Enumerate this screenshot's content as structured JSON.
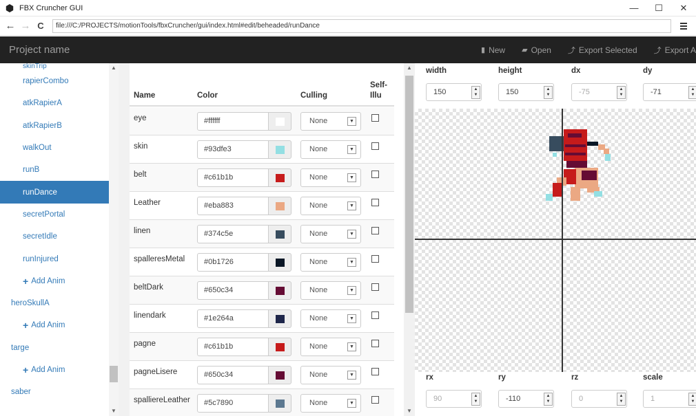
{
  "window": {
    "title": "FBX Cruncher GUI",
    "minimize": "—",
    "maximize": "☐",
    "close": "✕"
  },
  "browser": {
    "back": "←",
    "forward": "→",
    "reload": "C",
    "url": "file:///C:/PROJECTS/motionTools/fbxCruncher/gui/index.html#edit/beheaded/runDance"
  },
  "navbar": {
    "brand": "Project name",
    "items": [
      {
        "icon": "file-icon",
        "glyph": "▮",
        "label": "New"
      },
      {
        "icon": "folder-open-icon",
        "glyph": "▰",
        "label": "Open"
      },
      {
        "icon": "export-icon",
        "glyph": "⤴",
        "label": "Export Selected"
      },
      {
        "icon": "export-all-icon",
        "glyph": "⤴",
        "label": "Export A"
      }
    ]
  },
  "sidebar": {
    "cut_item": "skinTrip",
    "items": [
      {
        "label": "rapierCombo",
        "kind": "anim"
      },
      {
        "label": "atkRapierA",
        "kind": "anim"
      },
      {
        "label": "atkRapierB",
        "kind": "anim"
      },
      {
        "label": "walkOut",
        "kind": "anim"
      },
      {
        "label": "runB",
        "kind": "anim"
      },
      {
        "label": "runDance",
        "kind": "anim",
        "active": true
      },
      {
        "label": "secretPortal",
        "kind": "anim"
      },
      {
        "label": "secretIdle",
        "kind": "anim"
      },
      {
        "label": "runInjured",
        "kind": "anim"
      },
      {
        "label": "Add Anim",
        "kind": "add"
      },
      {
        "label": "heroSkullA",
        "kind": "group"
      },
      {
        "label": "Add Anim",
        "kind": "add"
      },
      {
        "label": "targe",
        "kind": "group"
      },
      {
        "label": "Add Anim",
        "kind": "add"
      },
      {
        "label": "saber",
        "kind": "group"
      }
    ]
  },
  "materials": {
    "headers": {
      "name": "Name",
      "color": "Color",
      "culling": "Culling",
      "selfillum_1": "Self-",
      "selfillum_2": "Illu"
    },
    "rows": [
      {
        "name": "eye",
        "color": "#ffffff",
        "culling": "None"
      },
      {
        "name": "skin",
        "color": "#93dfe3",
        "culling": "None"
      },
      {
        "name": "belt",
        "color": "#c61b1b",
        "culling": "None"
      },
      {
        "name": "Leather",
        "color": "#eba883",
        "culling": "None"
      },
      {
        "name": "linen",
        "color": "#374c5e",
        "culling": "None"
      },
      {
        "name": "spalleresMetal",
        "color": "#0b1726",
        "culling": "None"
      },
      {
        "name": "beltDark",
        "color": "#650c34",
        "culling": "None"
      },
      {
        "name": "linendark",
        "color": "#1e264a",
        "culling": "None"
      },
      {
        "name": "pagne",
        "color": "#c61b1b",
        "culling": "None"
      },
      {
        "name": "pagneLisere",
        "color": "#650c34",
        "culling": "None"
      },
      {
        "name": "spalliereLeather",
        "color": "#5c7890",
        "culling": "None"
      }
    ]
  },
  "transform_top": [
    {
      "label": "width",
      "value": "150",
      "disabled": false
    },
    {
      "label": "height",
      "value": "150",
      "disabled": false
    },
    {
      "label": "dx",
      "value": "-75",
      "disabled": true
    },
    {
      "label": "dy",
      "value": "-71",
      "disabled": false
    }
  ],
  "transform_bottom": [
    {
      "label": "rx",
      "value": "90",
      "disabled": true
    },
    {
      "label": "ry",
      "value": "-110",
      "disabled": false
    },
    {
      "label": "rz",
      "value": "0",
      "disabled": true
    },
    {
      "label": "scale",
      "value": "1",
      "disabled": true
    }
  ],
  "scroll_arrows": {
    "up": "▲",
    "down": "▼"
  },
  "spin_arrows": {
    "up": "▲",
    "down": "▼"
  },
  "select_arrow": "▼"
}
